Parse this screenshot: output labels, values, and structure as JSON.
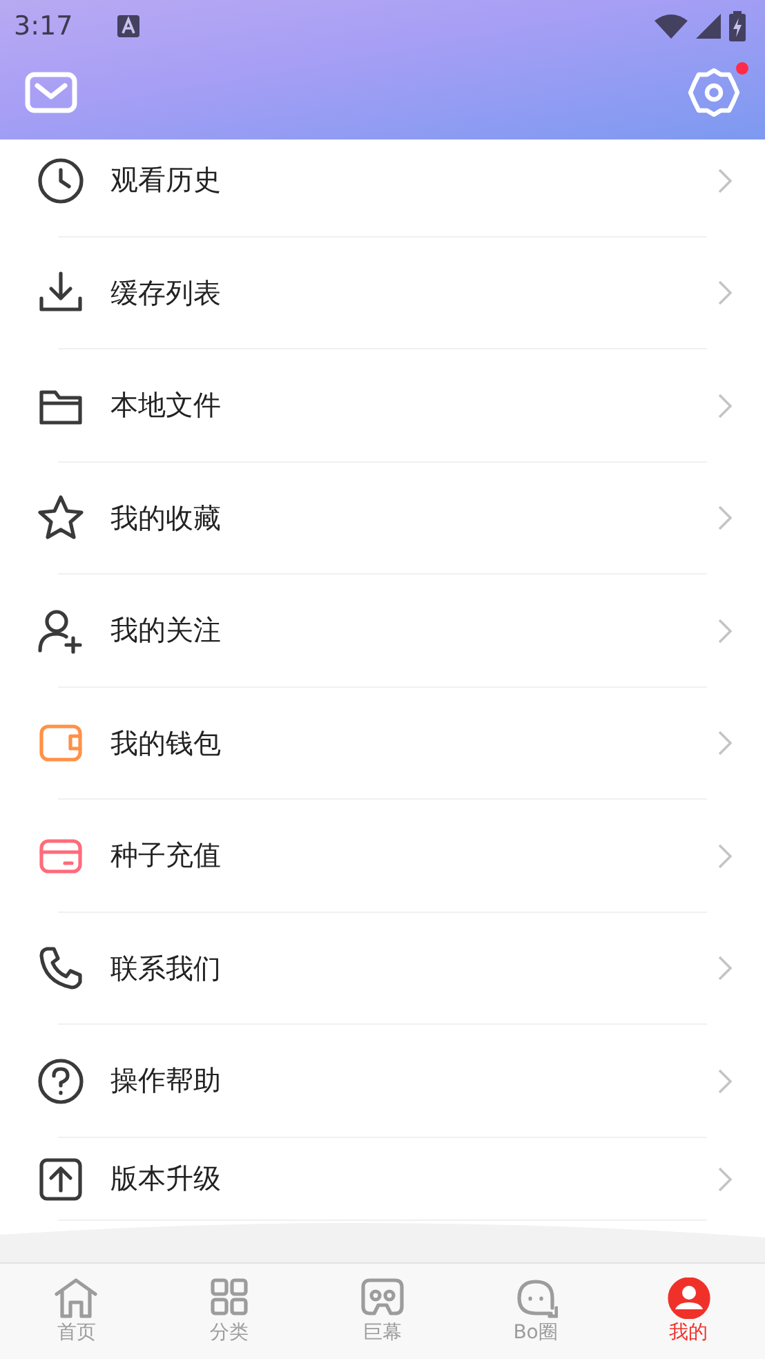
{
  "status_bar": {
    "time": "3:17"
  },
  "header": {
    "settings_badge": true
  },
  "menu": [
    {
      "label": "观看历史"
    },
    {
      "label": "缓存列表"
    },
    {
      "label": "本地文件"
    },
    {
      "label": "我的收藏"
    },
    {
      "label": "我的关注"
    },
    {
      "label": "我的钱包"
    },
    {
      "label": "种子充值"
    },
    {
      "label": "联系我们"
    },
    {
      "label": "操作帮助"
    },
    {
      "label": "版本升级"
    }
  ],
  "tabs": [
    {
      "label": "首页",
      "selected": false
    },
    {
      "label": "分类",
      "selected": false
    },
    {
      "label": "巨幕",
      "selected": false
    },
    {
      "label": "Bo圈",
      "selected": false
    },
    {
      "label": "我的",
      "selected": true
    }
  ]
}
